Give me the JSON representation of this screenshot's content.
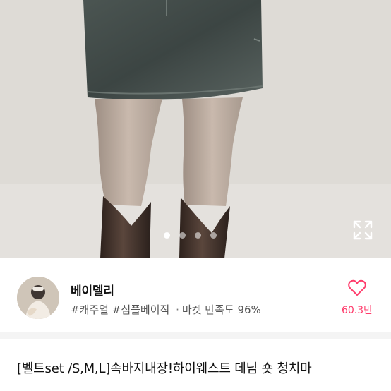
{
  "carousel": {
    "total_images": 4,
    "current_index": 1
  },
  "seller": {
    "name": "베이델리",
    "tags": [
      "#캐주얼",
      "#심플베이직"
    ],
    "separator": "·",
    "satisfaction_label": "마켓 만족도",
    "satisfaction_value": "96%"
  },
  "like": {
    "count": "60.3만",
    "color": "#ff3b6b"
  },
  "product": {
    "title": "[벨트set /S,M,L]속바지내장!하이웨스트 데님 숏 청치마"
  },
  "icons": {
    "expand": "expand-icon",
    "heart": "heart-icon"
  }
}
